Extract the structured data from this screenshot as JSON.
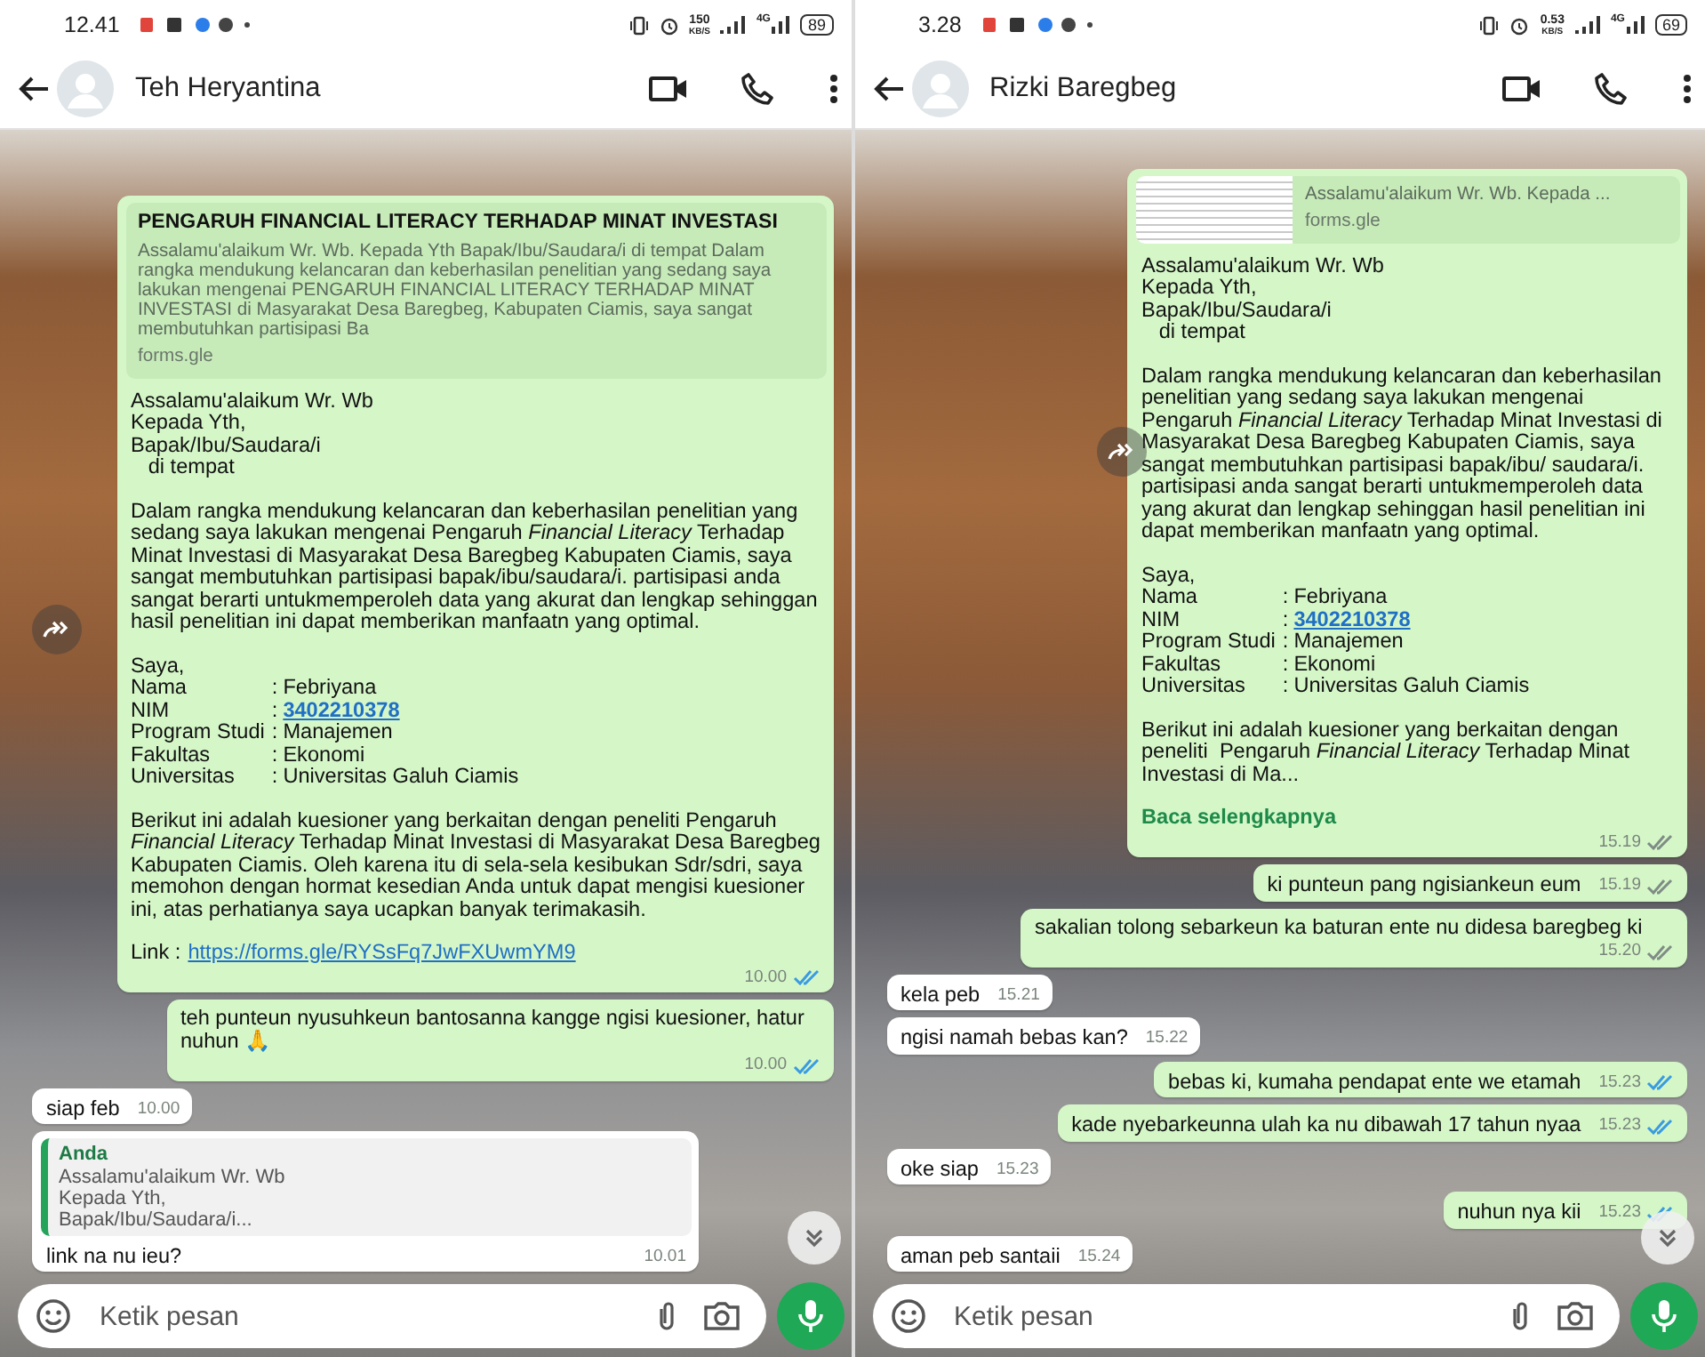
{
  "phones": [
    {
      "status_bar": {
        "time": "12.41",
        "speed": "150",
        "speed_unit": "KB/S",
        "network": "4G",
        "battery": "89"
      },
      "header": {
        "name": "Teh Heryantina"
      },
      "messages": [
        {
          "kind": "form",
          "sent": true,
          "forward": true,
          "preview": {
            "thumbnail": false,
            "title": "PENGARUH FINANCIAL LITERACY TERHADAP MINAT INVESTASI",
            "description": "Assalamu'alaikum Wr. Wb. Kepada Yth Bapak/Ibu/Saudara/i di tempat Dalam rangka mendukung kelancaran dan keberhasilan penelitian yang sedang saya lakukan mengenai PENGARUH FINANCIAL LITERACY TERHADAP MINAT INVESTASI di Masyarakat Desa Baregbeg, Kabupaten Ciamis, saya sangat membutuhkan partisipasi Ba",
            "domain": "forms.gle"
          },
          "blocks": [
            {
              "kind": "text",
              "text": "Assalamu'alaikum Wr. Wb\nKepada Yth,\nBapak/Ibu/Saudara/i\n   di tempat"
            },
            {
              "kind": "text",
              "text": "Dalam rangka mendukung kelancaran dan keberhasilan penelitian yang sedang saya lakukan mengenai Pengaruh *Financial Literacy* Terhadap Minat Investasi di Masyarakat Desa Baregbeg Kabupaten Ciamis, saya sangat membutuhkan partisipasi bapak/ibu/saudara/i. partisipasi anda sangat berarti untukmemperoleh data yang akurat dan lengkap sehinggan hasil penelitian ini dapat memberikan manfaatn yang optimal."
            },
            {
              "kind": "fields",
              "intro": "Saya,",
              "rows": [
                {
                  "label": "Nama",
                  "sep": ":",
                  "value": "Febriyana",
                  "link": false
                },
                {
                  "label": "NIM",
                  "sep": ":",
                  "value": "3402210378",
                  "link": true
                },
                {
                  "label": "Program Studi",
                  "sep": ":",
                  "value": "Manajemen",
                  "link": false
                },
                {
                  "label": "Fakultas",
                  "sep": ":",
                  "value": "Ekonomi",
                  "link": false
                },
                {
                  "label": "Universitas",
                  "sep": ":",
                  "value": "Universitas Galuh Ciamis",
                  "link": false
                }
              ]
            },
            {
              "kind": "text",
              "text": "Berikut ini adalah kuesioner yang berkaitan dengan peneliti Pengaruh *Financial Literacy* Terhadap Minat Investasi di Masyarakat Desa Baregbeg Kabupaten Ciamis. Oleh karena itu di sela-sela kesibukan Sdr/sdri, saya memohon dengan hormat kesedian Anda untuk dapat mengisi kuesioner ini, atas perhatianya saya ucapkan banyak terimakasih."
            },
            {
              "kind": "link",
              "label": "Link :",
              "url": "https://forms.gle/RYSsFq7JwFXUwmYM9"
            }
          ],
          "time": "10.00",
          "read": true
        },
        {
          "kind": "text",
          "sent": true,
          "text": "teh punteun nyusuhkeun bantosanna kangge ngisi kuesioner, hatur nuhun 🙏",
          "time": "10.00",
          "read": true
        },
        {
          "kind": "text",
          "sent": false,
          "text": "siap feb",
          "time": "10.00"
        },
        {
          "kind": "reply",
          "sent": false,
          "quote": {
            "author": "Anda",
            "text": "Assalamu'alaikum Wr. Wb\nKepada Yth,\nBapak/Ibu/Saudara/i..."
          },
          "text": "link na nu ieu?",
          "time": "10.01"
        }
      ],
      "scroll_down_button": true,
      "composer": {
        "placeholder": "Ketik pesan"
      }
    },
    {
      "status_bar": {
        "time": "3.28",
        "speed": "0.53",
        "speed_unit": "KB/S",
        "network": "4G",
        "battery": "69"
      },
      "header": {
        "name": "Rizki Baregbeg"
      },
      "messages": [
        {
          "kind": "form",
          "sent": true,
          "forward": true,
          "preview": {
            "thumbnail": true,
            "description": "Assalamu'alaikum Wr. Wb. Kepada ...",
            "domain": "forms.gle"
          },
          "blocks": [
            {
              "kind": "text",
              "text": "Assalamu'alaikum Wr. Wb\nKepada Yth,\nBapak/Ibu/Saudara/i\n   di tempat"
            },
            {
              "kind": "text",
              "text": "Dalam rangka mendukung kelancaran dan keberhasilan penelitian yang sedang saya lakukan mengenai Pengaruh *Financial Literacy* Terhadap Minat Investasi di Masyarakat Desa Baregbeg Kabupaten Ciamis, saya sangat membutuhkan partisipasi bapak/ibu/ saudara/i. partisipasi anda sangat berarti untukmemperoleh data yang akurat dan lengkap sehinggan hasil penelitian ini dapat memberikan manfaatn yang optimal."
            },
            {
              "kind": "fields",
              "intro": "Saya,",
              "rows": [
                {
                  "label": "Nama",
                  "sep": ":",
                  "value": "Febriyana",
                  "link": false
                },
                {
                  "label": "NIM",
                  "sep": ":",
                  "value": "3402210378",
                  "link": true
                },
                {
                  "label": "Program Studi",
                  "sep": ":",
                  "value": "Manajemen",
                  "link": false
                },
                {
                  "label": "Fakultas",
                  "sep": ":",
                  "value": "Ekonomi",
                  "link": false
                },
                {
                  "label": "Universitas",
                  "sep": ":",
                  "value": "Universitas Galuh Ciamis",
                  "link": false
                }
              ]
            },
            {
              "kind": "text",
              "text": "Berikut ini adalah kuesioner yang berkaitan dengan peneliti  Pengaruh *Financial Literacy* Terhadap Minat Investasi di Ma..."
            }
          ],
          "more": "Baca selengkapnya",
          "time": "15.19",
          "read": false
        },
        {
          "kind": "text",
          "sent": true,
          "text": "ki punteun pang ngisiankeun eum",
          "time": "15.19",
          "read": false
        },
        {
          "kind": "text",
          "sent": true,
          "text": "sakalian tolong sebarkeun ka baturan ente nu didesa baregbeg ki",
          "time": "15.20",
          "read": false
        },
        {
          "kind": "text",
          "sent": false,
          "text": "kela peb",
          "time": "15.21"
        },
        {
          "kind": "text",
          "sent": false,
          "text": "ngisi namah bebas kan?",
          "time": "15.22"
        },
        {
          "kind": "text",
          "sent": true,
          "text": "bebas ki, kumaha pendapat ente we etamah",
          "time": "15.23",
          "read": true
        },
        {
          "kind": "text",
          "sent": true,
          "text": "kade nyebarkeunna ulah ka nu dibawah 17 tahun nyaa",
          "time": "15.23",
          "read": true
        },
        {
          "kind": "text",
          "sent": false,
          "text": "oke siap",
          "time": "15.23"
        },
        {
          "kind": "text",
          "sent": true,
          "text": "nuhun nya kii",
          "time": "15.23",
          "read": true
        },
        {
          "kind": "text",
          "sent": false,
          "text": "aman peb santaii",
          "time": "15.24"
        }
      ],
      "scroll_down_button": true,
      "composer": {
        "placeholder": "Ketik pesan"
      }
    }
  ]
}
